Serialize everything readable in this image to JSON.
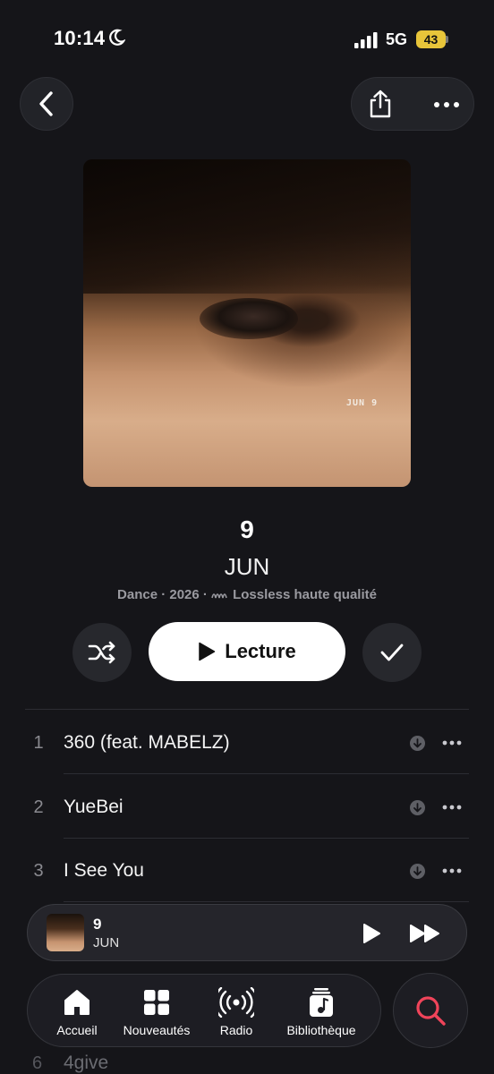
{
  "status_bar": {
    "time": "10:14",
    "network": "5G",
    "battery": "43",
    "icons": [
      "moon-icon",
      "signal-icon",
      "battery-icon"
    ]
  },
  "header": {
    "icons": [
      "chevron-left-icon",
      "share-icon",
      "more-icon"
    ]
  },
  "album": {
    "cover_text": "JUN 9",
    "title": "9",
    "artist": "JUN",
    "meta": "Dance · 2026 ·",
    "quality": "Lossless haute qualité"
  },
  "actions": {
    "play_label": "Lecture",
    "icons": [
      "shuffle-icon",
      "play-icon",
      "checkmark-icon"
    ]
  },
  "tracks": [
    {
      "number": "1",
      "title": "360 (feat. MABELZ)"
    },
    {
      "number": "2",
      "title": "YueBei"
    },
    {
      "number": "3",
      "title": "I See You"
    },
    {
      "number": "6",
      "title": "4give"
    }
  ],
  "mini_player": {
    "title": "9",
    "artist": "JUN",
    "icons": [
      "play-icon",
      "fast-forward-icon"
    ]
  },
  "tab_bar": {
    "tabs": [
      {
        "label": "Accueil",
        "icon": "home-icon"
      },
      {
        "label": "Nouveautés",
        "icon": "grid-icon"
      },
      {
        "label": "Radio",
        "icon": "radio-icon"
      },
      {
        "label": "Bibliothèque",
        "icon": "library-icon"
      }
    ],
    "search_icon": "search-icon"
  },
  "colors": {
    "background": "#151519",
    "accent_search": "#f0445a",
    "battery": "#e8c53a"
  }
}
